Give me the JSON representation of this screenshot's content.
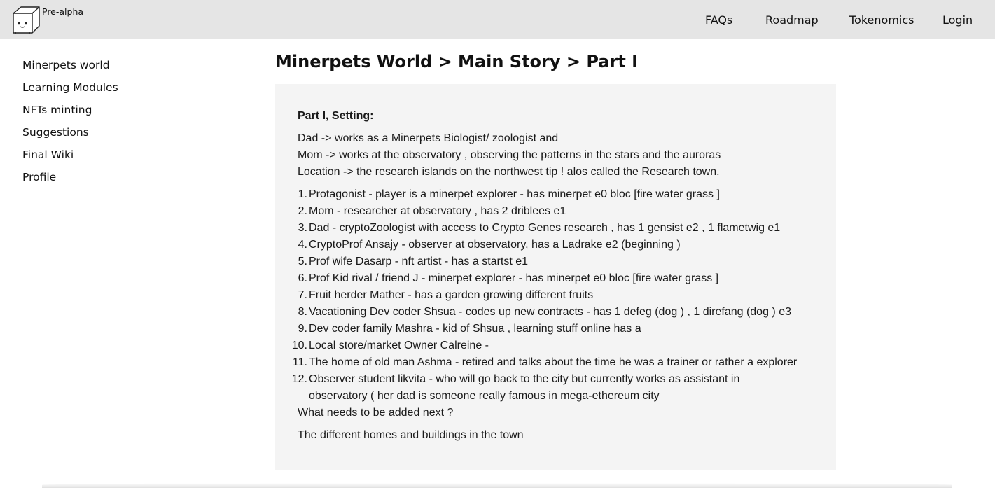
{
  "header": {
    "logo_text": "Pre-alpha",
    "nav": [
      "FAQs",
      "Roadmap",
      "Tokenomics",
      "Login"
    ]
  },
  "sidebar": {
    "items": [
      "Minerpets world",
      "Learning Modules",
      "NFTs minting",
      "Suggestions",
      "Final Wiki",
      "Profile"
    ]
  },
  "main": {
    "breadcrumb": "Minerpets World > Main Story > Part I",
    "section_title": "Part I, Setting:",
    "setting_lines": [
      "Dad -> works as a Minerpets Biologist/ zoologist and",
      "Mom -> works at the observatory , observing the patterns in the stars and the auroras",
      "Location -> the research islands on the northwest tip ! alos called the Research town."
    ],
    "characters": [
      "Protagonist - player is a minerpet explorer - has minerpet e0 bloc [fire water grass ]",
      "Mom - researcher at observatory , has 2 driblees e1",
      "Dad - cryptoZoologist with access to Crypto Genes research , has 1 gensist e2 , 1 flametwig e1",
      "CryptoProf Ansajy - observer at observatory, has a Ladrake e2 (beginning )",
      "Prof wife Dasarp - nft artist - has a startst e1",
      "Prof Kid rival / friend J - minerpet explorer - has minerpet e0 bloc [fire water grass ]",
      "Fruit herder Mather - has a garden growing different fruits",
      "Vacationing Dev coder Shsua - codes up new contracts - has 1 defeg (dog ) , 1 direfang (dog ) e3",
      "Dev coder family Mashra - kid of Shsua , learning stuff online has a",
      "Local store/market Owner Calreine -",
      "The home of old man Ashma - retired and talks about the time he was a trainer or rather a explorer",
      "Observer student likvita - who will go back to the city but currently works as assistant in observatory ( her dad is someone really famous in mega-ethereum city"
    ],
    "next_question": "What needs to be added next ?",
    "next_answer": "The different homes and buildings in the town"
  }
}
